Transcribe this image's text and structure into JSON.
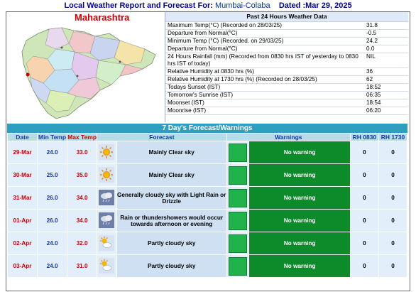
{
  "header": {
    "title_prefix": "Local Weather Report and Forecast For:",
    "location": "Mumbai-Colaba",
    "dated": "Dated :Mar 29, 2025"
  },
  "map": {
    "state_name": "Maharashtra"
  },
  "past24": {
    "heading": "Past 24 Hours Weather Data",
    "rows": [
      {
        "label": "Maximum Temp(°C) (Recorded on 28/03/25)",
        "value": "31.8"
      },
      {
        "label": "Departure from Normal(°C)",
        "value": "-0.5"
      },
      {
        "label": "Minimum Temp (°C) (Recorded. on 29/03/25)",
        "value": "24.2"
      },
      {
        "label": "Departure from Normal(°C)",
        "value": "0.0"
      },
      {
        "label": "24 Hours Rainfall (mm) (Recorded from 0830 hrs IST of yesterday to 0830 hrs IST of today)",
        "value": "NIL"
      },
      {
        "label": "Relative Humidity at 0830 hrs (%)",
        "value": "36"
      },
      {
        "label": "Relative Humidity at 1730 hrs (%) (Recorded on 28/03/25)",
        "value": "62"
      },
      {
        "label": "Todays Sunset (IST)",
        "value": "18:52"
      },
      {
        "label": "Tomorrow's Sunrise (IST)",
        "value": "06:35"
      },
      {
        "label": "Moonset (IST)",
        "value": "18:54"
      },
      {
        "label": "Moonrise (IST)",
        "value": "06:20"
      }
    ]
  },
  "forecast": {
    "title": "7 Day's Forecast/Warnings",
    "headers": {
      "date": "Date",
      "min": "Min Temp",
      "max": "Max Temp",
      "forecast": "Forecast",
      "warnings": "Warnings",
      "rh1": "RH 0830",
      "rh2": "RH 1730"
    },
    "rows": [
      {
        "date": "29-Mar",
        "min": "24.0",
        "max": "33.0",
        "icon": "sun-icon",
        "text": "Mainly Clear sky",
        "warning": "No warning",
        "rh1": "0",
        "rh2": "0"
      },
      {
        "date": "30-Mar",
        "min": "25.0",
        "max": "35.0",
        "icon": "sun-icon",
        "text": "Mainly Clear sky",
        "warning": "No warning",
        "rh1": "0",
        "rh2": "0"
      },
      {
        "date": "31-Mar",
        "min": "26.0",
        "max": "34.0",
        "icon": "cloud-rain-icon",
        "text": "Generally cloudy sky with Light Rain or Drizzle",
        "warning": "No warning",
        "rh1": "0",
        "rh2": "0"
      },
      {
        "date": "01-Apr",
        "min": "26.0",
        "max": "34.0",
        "icon": "cloud-rain-icon",
        "text": "Rain or thundershowers would occur towards afternoon or evening",
        "warning": "No warning",
        "rh1": "0",
        "rh2": "0"
      },
      {
        "date": "02-Apr",
        "min": "24.0",
        "max": "32.0",
        "icon": "partly-cloudy-icon",
        "text": "Partly cloudy sky",
        "warning": "No warning",
        "rh1": "0",
        "rh2": "0"
      },
      {
        "date": "03-Apr",
        "min": "24.0",
        "max": "31.0",
        "icon": "partly-cloudy-icon",
        "text": "Partly cloudy sky",
        "warning": "No warning",
        "rh1": "0",
        "rh2": "0"
      }
    ]
  }
}
